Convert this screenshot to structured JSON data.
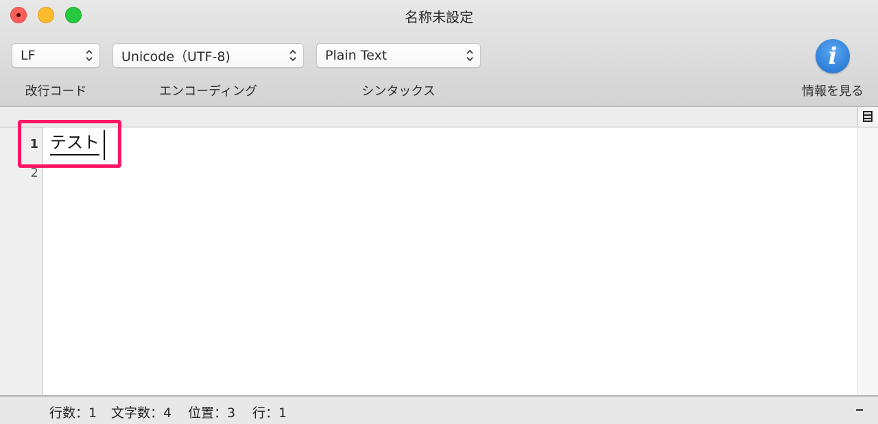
{
  "window": {
    "title": "名称未設定",
    "buttons": {
      "close": "close-button",
      "minimize": "minimize-button",
      "zoom": "zoom-button"
    }
  },
  "toolbar": {
    "line_ending": {
      "value": "LF",
      "label": "改行コード"
    },
    "encoding": {
      "value": "Unicode（UTF-8)",
      "label": "エンコーディング"
    },
    "syntax": {
      "value": "Plain Text",
      "label": "シンタックス"
    },
    "info": {
      "icon": "i",
      "label": "情報を見る"
    }
  },
  "editor": {
    "line_numbers": [
      "1",
      "2"
    ],
    "text": "テスト"
  },
  "statusbar": {
    "lines": "行数：1",
    "chars": "文字数：4",
    "position": "位置：3",
    "line": "行：1"
  },
  "annotation": {
    "color": "#ff1766"
  }
}
